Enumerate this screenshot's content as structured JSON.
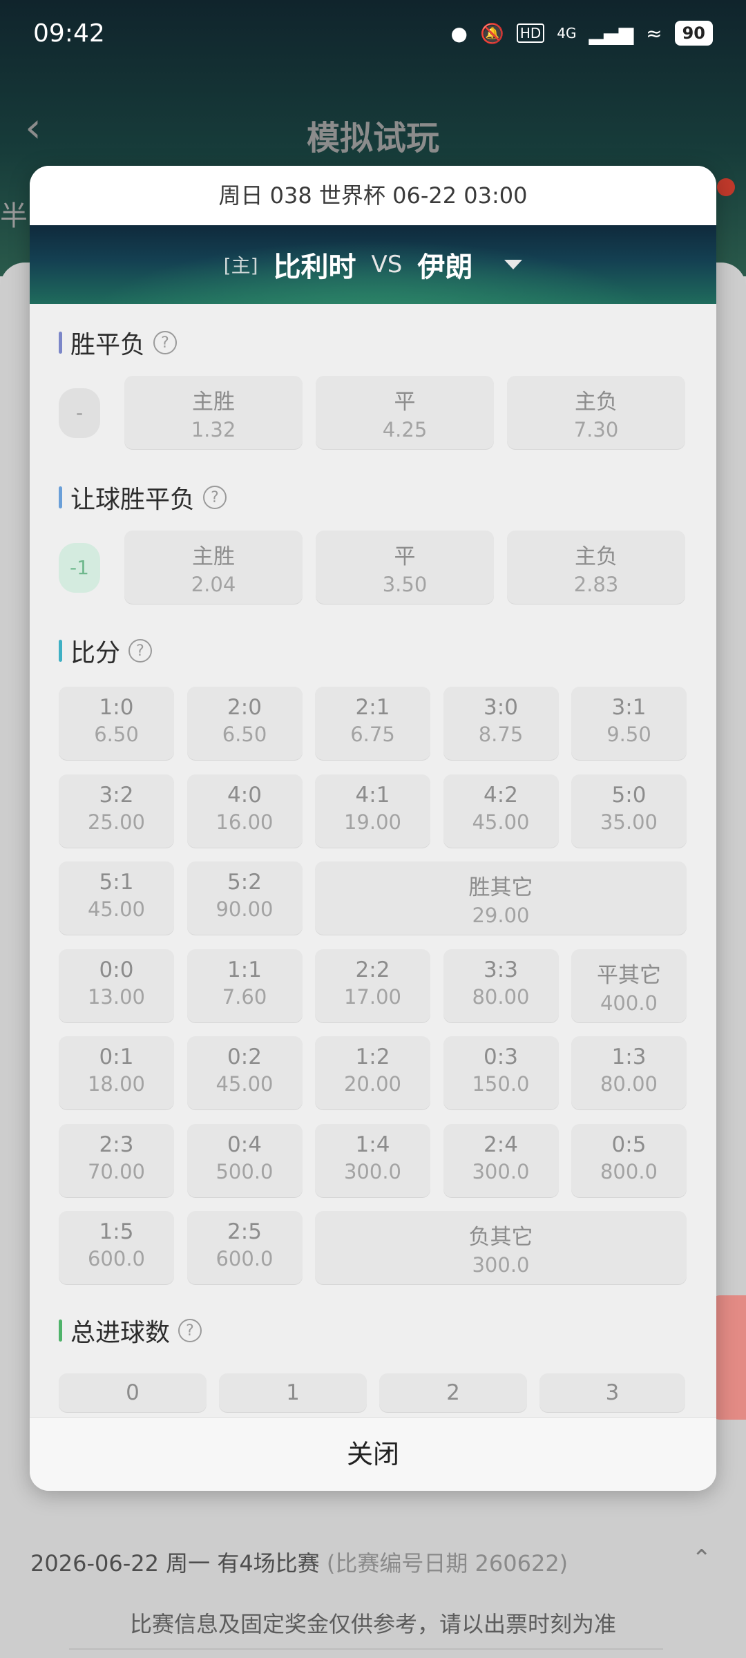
{
  "status_bar": {
    "time": "09:42",
    "network": "4G",
    "battery": "90",
    "icons": [
      "location-icon",
      "mute-icon",
      "hd-icon",
      "signal-icon",
      "wifi-icon",
      "battery-icon"
    ]
  },
  "background": {
    "title": "模拟试玩",
    "left_edge_text": "半",
    "date_row": "2026-06-22 周一 有4场比赛",
    "date_row_note": "(比赛编号日期 260622)",
    "footer_note": "比赛信息及固定奖金仅供参考，请以出票时刻为准"
  },
  "modal": {
    "header": "周日 038 世界杯 06-22 03:00",
    "home_tag": "[主]",
    "home_team": "比利时",
    "vs": "VS",
    "away_team": "伊朗",
    "close_label": "关闭",
    "sections": {
      "spf": {
        "title": "胜平负",
        "handicap": "-",
        "options": [
          {
            "label": "主胜",
            "odds": "1.32"
          },
          {
            "label": "平",
            "odds": "4.25"
          },
          {
            "label": "主负",
            "odds": "7.30"
          }
        ]
      },
      "rqspf": {
        "title": "让球胜平负",
        "handicap": "-1",
        "options": [
          {
            "label": "主胜",
            "odds": "2.04"
          },
          {
            "label": "平",
            "odds": "3.50"
          },
          {
            "label": "主负",
            "odds": "2.83"
          }
        ]
      },
      "score": {
        "title": "比分",
        "rows": [
          [
            {
              "label": "1:0",
              "odds": "6.50"
            },
            {
              "label": "2:0",
              "odds": "6.50"
            },
            {
              "label": "2:1",
              "odds": "6.75"
            },
            {
              "label": "3:0",
              "odds": "8.75"
            },
            {
              "label": "3:1",
              "odds": "9.50"
            }
          ],
          [
            {
              "label": "3:2",
              "odds": "25.00"
            },
            {
              "label": "4:0",
              "odds": "16.00"
            },
            {
              "label": "4:1",
              "odds": "19.00"
            },
            {
              "label": "4:2",
              "odds": "45.00"
            },
            {
              "label": "5:0",
              "odds": "35.00"
            }
          ],
          [
            {
              "label": "5:1",
              "odds": "45.00"
            },
            {
              "label": "5:2",
              "odds": "90.00"
            },
            {
              "label": "胜其它",
              "odds": "29.00"
            }
          ],
          [
            {
              "label": "0:0",
              "odds": "13.00"
            },
            {
              "label": "1:1",
              "odds": "7.60"
            },
            {
              "label": "2:2",
              "odds": "17.00"
            },
            {
              "label": "3:3",
              "odds": "80.00"
            },
            {
              "label": "平其它",
              "odds": "400.0"
            }
          ],
          [
            {
              "label": "0:1",
              "odds": "18.00"
            },
            {
              "label": "0:2",
              "odds": "45.00"
            },
            {
              "label": "1:2",
              "odds": "20.00"
            },
            {
              "label": "0:3",
              "odds": "150.0"
            },
            {
              "label": "1:3",
              "odds": "80.00"
            }
          ],
          [
            {
              "label": "2:3",
              "odds": "70.00"
            },
            {
              "label": "0:4",
              "odds": "500.0"
            },
            {
              "label": "1:4",
              "odds": "300.0"
            },
            {
              "label": "2:4",
              "odds": "300.0"
            },
            {
              "label": "0:5",
              "odds": "800.0"
            }
          ],
          [
            {
              "label": "1:5",
              "odds": "600.0"
            },
            {
              "label": "2:5",
              "odds": "600.0"
            },
            {
              "label": "负其它",
              "odds": "300.0"
            }
          ]
        ]
      },
      "goals": {
        "title": "总进球数",
        "options": [
          "0",
          "1",
          "2",
          "3"
        ]
      }
    }
  },
  "colors": {
    "spf_bar": "#7b86c8",
    "rqspf_bar": "#6a9fd8",
    "score_bar": "#3fb0c4",
    "goals_bar": "#4fb36a"
  }
}
